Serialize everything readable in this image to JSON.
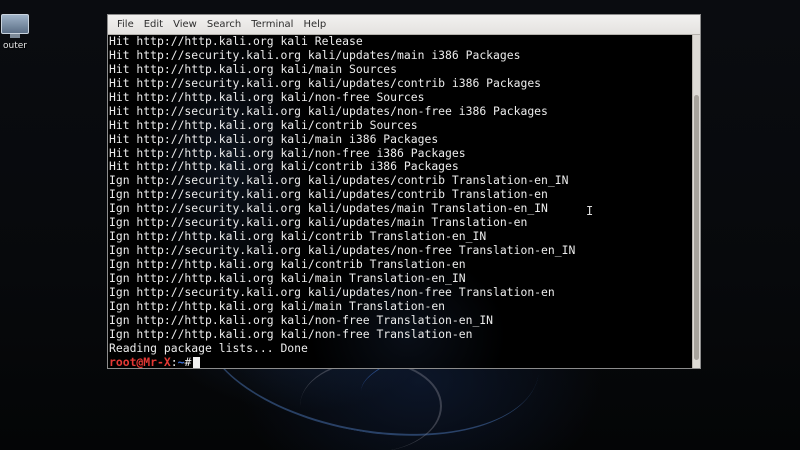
{
  "desktop": {
    "icon_label": "outer",
    "icon_name": "computer-icon"
  },
  "menubar": {
    "items": [
      "File",
      "Edit",
      "View",
      "Search",
      "Terminal",
      "Help"
    ]
  },
  "terminal": {
    "lines": [
      "Hit http://http.kali.org kali Release",
      "Hit http://security.kali.org kali/updates/main i386 Packages",
      "Hit http://http.kali.org kali/main Sources",
      "Hit http://security.kali.org kali/updates/contrib i386 Packages",
      "Hit http://http.kali.org kali/non-free Sources",
      "Hit http://security.kali.org kali/updates/non-free i386 Packages",
      "Hit http://http.kali.org kali/contrib Sources",
      "Hit http://http.kali.org kali/main i386 Packages",
      "Hit http://http.kali.org kali/non-free i386 Packages",
      "Hit http://http.kali.org kali/contrib i386 Packages",
      "Ign http://security.kali.org kali/updates/contrib Translation-en_IN",
      "Ign http://security.kali.org kali/updates/contrib Translation-en",
      "Ign http://security.kali.org kali/updates/main Translation-en_IN",
      "Ign http://security.kali.org kali/updates/main Translation-en",
      "Ign http://http.kali.org kali/contrib Translation-en_IN",
      "Ign http://security.kali.org kali/updates/non-free Translation-en_IN",
      "Ign http://http.kali.org kali/contrib Translation-en",
      "Ign http://http.kali.org kali/main Translation-en_IN",
      "Ign http://security.kali.org kali/updates/non-free Translation-en",
      "Ign http://http.kali.org kali/main Translation-en",
      "Ign http://http.kali.org kali/non-free Translation-en_IN",
      "Ign http://http.kali.org kali/non-free Translation-en",
      "Reading package lists... Done"
    ],
    "prompt": {
      "user_host": "root@Mr-X",
      "separator": ":",
      "path": "~",
      "symbol": "#"
    }
  },
  "colors": {
    "prompt_user": "#e53935",
    "prompt_path": "#3b6fd6",
    "text": "#ececec",
    "background": "#000000",
    "menubar": "#ebe9e6"
  }
}
